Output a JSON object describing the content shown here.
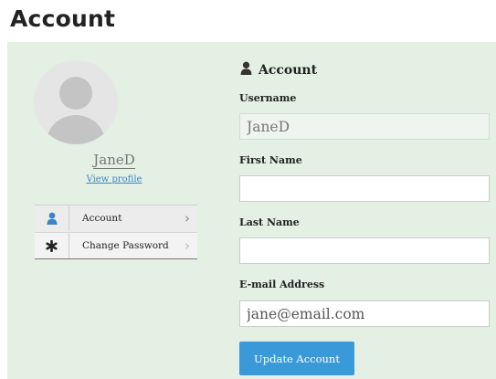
{
  "page": {
    "title": "Account"
  },
  "profile": {
    "username": "JaneD",
    "view_profile_label": "View profile"
  },
  "side_menu": {
    "items": [
      {
        "label": "Account",
        "icon": "user-icon",
        "active": true
      },
      {
        "label": "Change Password",
        "icon": "asterisk-icon",
        "active": false
      }
    ]
  },
  "form": {
    "title": "Account",
    "title_icon": "user-icon",
    "username": {
      "label": "Username",
      "value": "JaneD",
      "readonly": true
    },
    "first_name": {
      "label": "First Name",
      "value": ""
    },
    "last_name": {
      "label": "Last Name",
      "value": ""
    },
    "email": {
      "label": "E-mail Address",
      "value": "jane@email.com"
    },
    "submit_label": "Update Account"
  },
  "colors": {
    "panel_background": "#e3f0e3",
    "accent": "#3a9ad9",
    "link": "#3a86c8"
  }
}
